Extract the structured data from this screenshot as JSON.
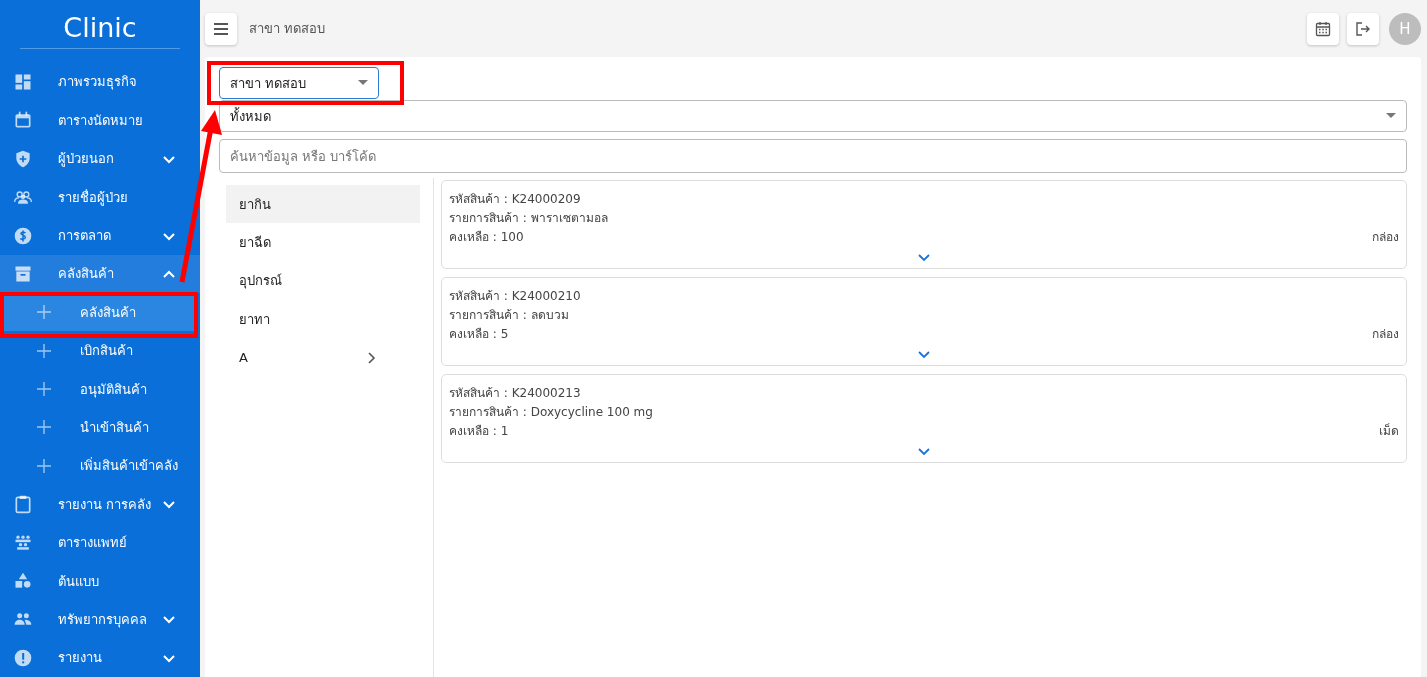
{
  "sidebar": {
    "title": "Clinic",
    "items": [
      {
        "label": "ภาพรวมธุรกิจ",
        "kind": "link",
        "selected": false
      },
      {
        "label": "ตารางนัดหมาย",
        "kind": "link",
        "selected": false
      },
      {
        "label": "ผู้ป่วยนอก",
        "kind": "group",
        "expanded": false,
        "selected": false
      },
      {
        "label": "รายชื่อผู้ป่วย",
        "kind": "link",
        "selected": false
      },
      {
        "label": "การตลาด",
        "kind": "group",
        "expanded": false,
        "selected": false
      },
      {
        "label": "คลังสินค้า",
        "kind": "group",
        "expanded": true,
        "selected": true,
        "children": [
          {
            "label": "คลังสินค้า",
            "selected": true
          },
          {
            "label": "เบิกสินค้า",
            "selected": false
          },
          {
            "label": "อนุมัติสินค้า",
            "selected": false
          },
          {
            "label": "นำเข้าสินค้า",
            "selected": false
          },
          {
            "label": "เพิ่มสินค้าเข้าคลัง",
            "selected": false
          }
        ]
      },
      {
        "label": "รายงาน การคลัง",
        "kind": "group",
        "expanded": false,
        "selected": false
      },
      {
        "label": "ตารางแพทย์",
        "kind": "link",
        "selected": false
      },
      {
        "label": "ต้นแบบ",
        "kind": "link",
        "selected": false
      },
      {
        "label": "ทรัพยากรบุคคล",
        "kind": "group",
        "expanded": false,
        "selected": false
      },
      {
        "label": "รายงาน",
        "kind": "group",
        "expanded": false,
        "selected": false
      }
    ]
  },
  "topbar": {
    "title": "สาขา ทดสอบ",
    "avatar": "H"
  },
  "filters": {
    "branch": "สาขา ทดสอบ",
    "category": "ทั้งหมด",
    "search_placeholder": "ค้นหาข้อมูล หรือ บาร์โค้ด"
  },
  "categories": [
    {
      "label": "ยากิน",
      "selected": true,
      "expandable": false
    },
    {
      "label": "ยาฉีด",
      "selected": false,
      "expandable": false
    },
    {
      "label": "อุปกรณ์",
      "selected": false,
      "expandable": false
    },
    {
      "label": "ยาทา",
      "selected": false,
      "expandable": false
    },
    {
      "label": "A",
      "selected": false,
      "expandable": true
    }
  ],
  "products": [
    {
      "code": "รหัสสินค้า : K24000209",
      "name": "รายการสินค้า : พาราเซตามอล",
      "remaining": "คงเหลือ : 100",
      "unit": "กล่อง"
    },
    {
      "code": "รหัสสินค้า : K24000210",
      "name": "รายการสินค้า : ลดบวม",
      "remaining": "คงเหลือ : 5",
      "unit": "กล่อง"
    },
    {
      "code": "รหัสสินค้า : K24000213",
      "name": "รายการสินค้า : Doxycycline 100 mg",
      "remaining": "คงเหลือ : 1",
      "unit": "เม็ด"
    }
  ]
}
